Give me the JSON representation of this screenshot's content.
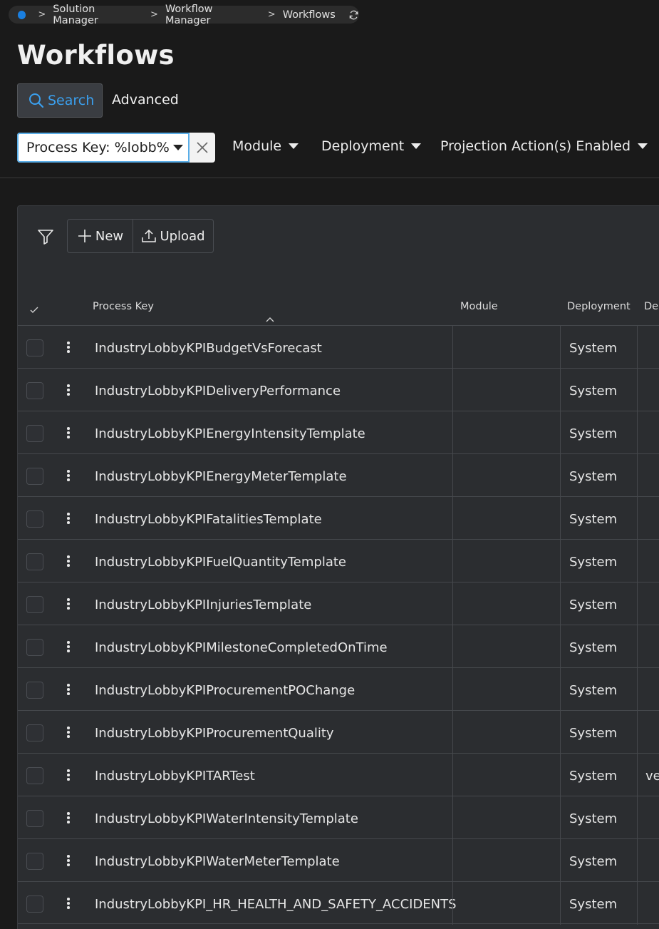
{
  "breadcrumb": {
    "items": [
      "Solution Manager",
      "Workflow Manager",
      "Workflows"
    ]
  },
  "page": {
    "title": "Workflows"
  },
  "search_tabs": {
    "search": "Search",
    "advanced": "Advanced"
  },
  "filters": {
    "active_chip": "Process Key: %lobb%",
    "dropdowns": [
      "Module",
      "Deployment",
      "Projection Action(s) Enabled"
    ]
  },
  "toolbar": {
    "new_label": "New",
    "upload_label": "Upload"
  },
  "table": {
    "columns": [
      "Process Key",
      "Module",
      "Deployment",
      "De"
    ],
    "rows": [
      {
        "key": "IndustryLobbyKPIBudgetVsForecast",
        "module": "",
        "deployment": "System",
        "extra": ""
      },
      {
        "key": "IndustryLobbyKPIDeliveryPerformance",
        "module": "",
        "deployment": "System",
        "extra": ""
      },
      {
        "key": "IndustryLobbyKPIEnergyIntensityTemplate",
        "module": "",
        "deployment": "System",
        "extra": ""
      },
      {
        "key": "IndustryLobbyKPIEnergyMeterTemplate",
        "module": "",
        "deployment": "System",
        "extra": ""
      },
      {
        "key": "IndustryLobbyKPIFatalitiesTemplate",
        "module": "",
        "deployment": "System",
        "extra": ""
      },
      {
        "key": "IndustryLobbyKPIFuelQuantityTemplate",
        "module": "",
        "deployment": "System",
        "extra": ""
      },
      {
        "key": "IndustryLobbyKPIInjuriesTemplate",
        "module": "",
        "deployment": "System",
        "extra": ""
      },
      {
        "key": "IndustryLobbyKPIMilestoneCompletedOnTime",
        "module": "",
        "deployment": "System",
        "extra": ""
      },
      {
        "key": "IndustryLobbyKPIProcurementPOChange",
        "module": "",
        "deployment": "System",
        "extra": ""
      },
      {
        "key": "IndustryLobbyKPIProcurementQuality",
        "module": "",
        "deployment": "System",
        "extra": ""
      },
      {
        "key": "IndustryLobbyKPITARTest",
        "module": "",
        "deployment": "System",
        "extra": "ve"
      },
      {
        "key": "IndustryLobbyKPIWaterIntensityTemplate",
        "module": "",
        "deployment": "System",
        "extra": ""
      },
      {
        "key": "IndustryLobbyKPIWaterMeterTemplate",
        "module": "",
        "deployment": "System",
        "extra": ""
      },
      {
        "key": "IndustryLobbyKPI_HR_HEALTH_AND_SAFETY_ACCIDENTS",
        "module": "",
        "deployment": "System",
        "extra": ""
      }
    ]
  },
  "colors": {
    "accent": "#3aa0ef",
    "brand_dot": "#1a7fe0",
    "background": "#1a1a1a",
    "panel": "#2b2d30"
  }
}
